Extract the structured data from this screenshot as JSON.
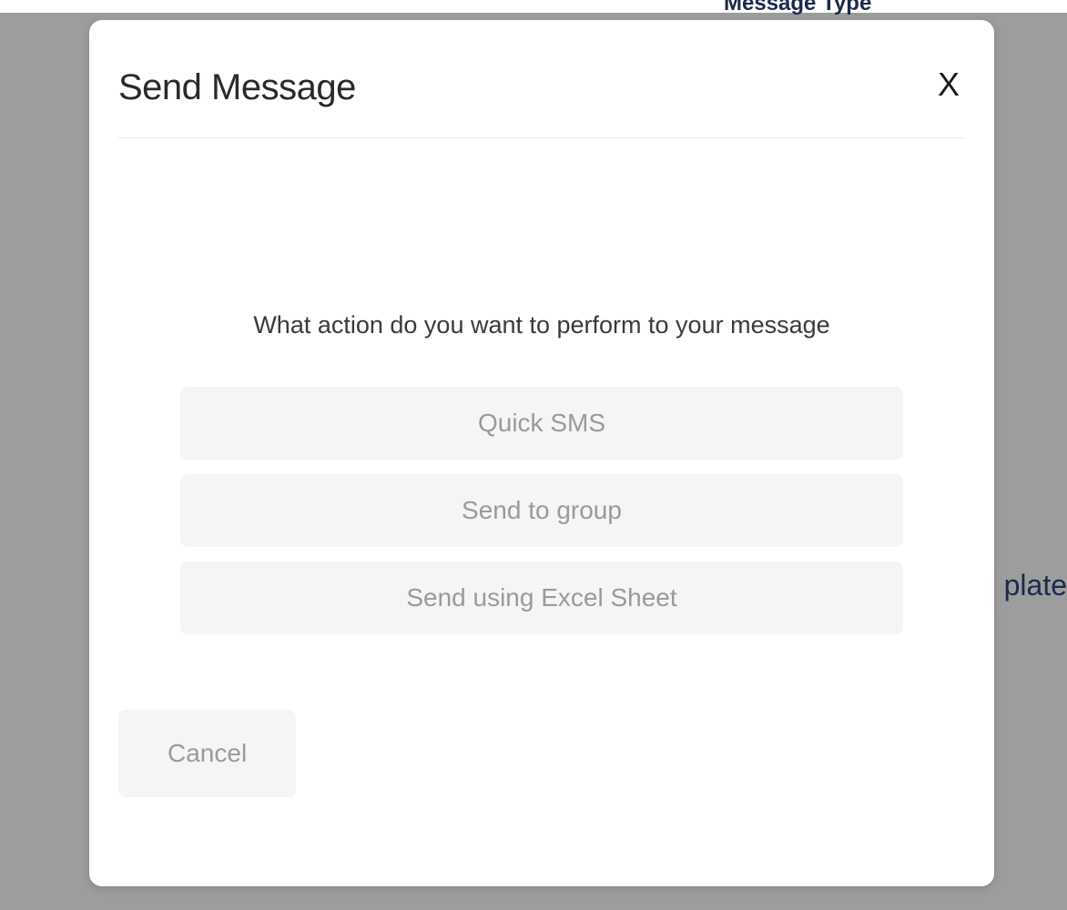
{
  "background": {
    "header_label": "Message Type",
    "template_text": "plate"
  },
  "modal": {
    "title": "Send Message",
    "close_label": "X",
    "prompt": "What action do you want to perform to your message",
    "options": [
      {
        "label": "Quick SMS"
      },
      {
        "label": "Send to group"
      },
      {
        "label": "Send using Excel Sheet"
      }
    ],
    "cancel_label": "Cancel"
  }
}
